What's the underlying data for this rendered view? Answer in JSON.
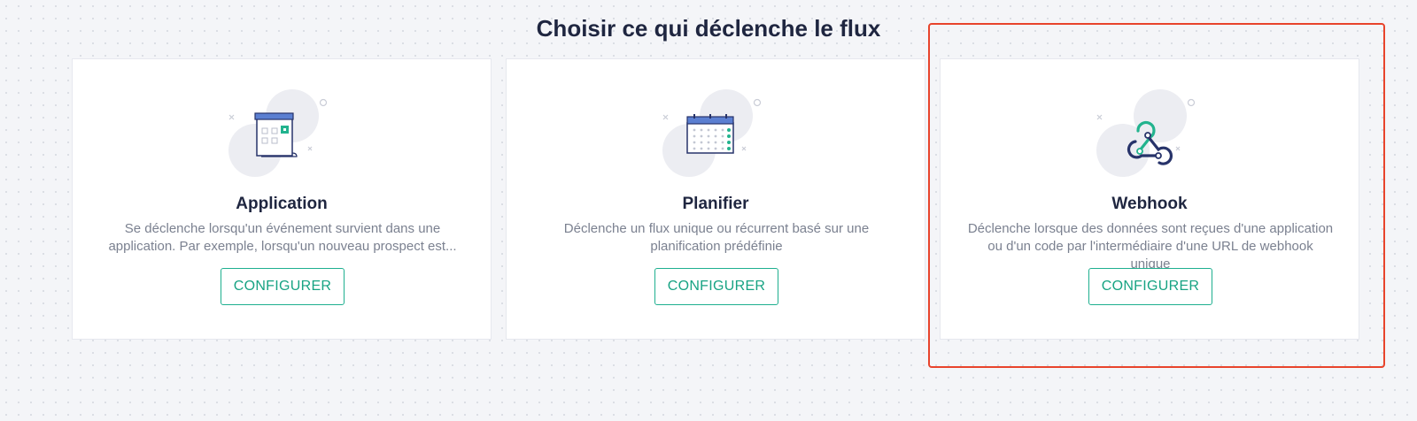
{
  "page": {
    "title": "Choisir ce qui déclenche le flux"
  },
  "cards": [
    {
      "title": "Application",
      "description": "Se déclenche lorsqu'un événement survient dans une application. Par exemple, lorsqu'un nouveau prospect est...",
      "button_label": "CONFIGURER",
      "icon": "app-window-icon"
    },
    {
      "title": "Planifier",
      "description": "Déclenche un flux unique ou récurrent basé sur une planification prédéfinie",
      "button_label": "CONFIGURER",
      "icon": "calendar-icon"
    },
    {
      "title": "Webhook",
      "description": "Déclenche lorsque des données sont reçues d'une application ou d'un code par l'intermédiaire d'une URL de webhook unique",
      "button_label": "CONFIGURER",
      "icon": "webhook-icon",
      "highlighted": true
    }
  ],
  "colors": {
    "accent": "#1eaf8f",
    "highlight": "#e8442c",
    "title": "#1f2640",
    "text_muted": "#7b8190",
    "background": "#f4f5f8"
  }
}
